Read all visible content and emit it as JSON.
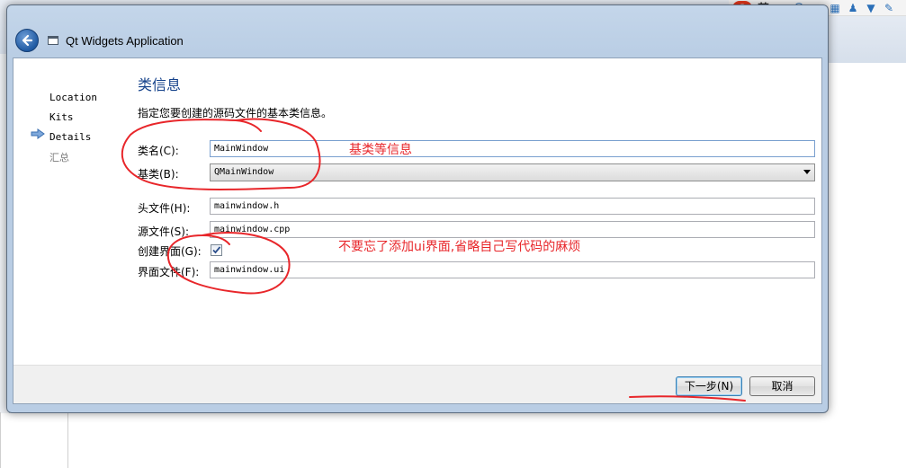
{
  "ime": {
    "logo": "S",
    "lang": "英",
    "icons": [
      "punctuation-icon",
      "emoji-icon",
      "microphone-icon",
      "keyboard-icon",
      "user-icon",
      "shirt-icon",
      "tools-icon"
    ]
  },
  "dialog": {
    "title": "Qt Widgets Application",
    "sidebar": [
      {
        "label": "Location",
        "state": "done"
      },
      {
        "label": "Kits",
        "state": "done"
      },
      {
        "label": "Details",
        "state": "current"
      },
      {
        "label": "汇总",
        "state": "pending"
      }
    ],
    "page_title": "类信息",
    "description": "指定您要创建的源码文件的基本类信息。",
    "fields": {
      "class_name": {
        "label": "类名(C):",
        "value": "MainWindow"
      },
      "base_class": {
        "label": "基类(B):",
        "value": "QMainWindow"
      },
      "header_file": {
        "label": "头文件(H):",
        "value": "mainwindow.h"
      },
      "source_file": {
        "label": "源文件(S):",
        "value": "mainwindow.cpp"
      },
      "generate_form": {
        "label": "创建界面(G):",
        "checked": true
      },
      "form_file": {
        "label": "界面文件(F):",
        "value": "mainwindow.ui"
      }
    },
    "buttons": {
      "next": "下一步(N)",
      "cancel": "取消"
    }
  },
  "annotations": {
    "base_class_note": "基类等信息",
    "ui_note": "不要忘了添加ui界面,省略自己写代码的麻烦"
  },
  "colors": {
    "annotation": "#e8262a",
    "title_blue": "#15428b",
    "accent": "#1f5aa3"
  }
}
